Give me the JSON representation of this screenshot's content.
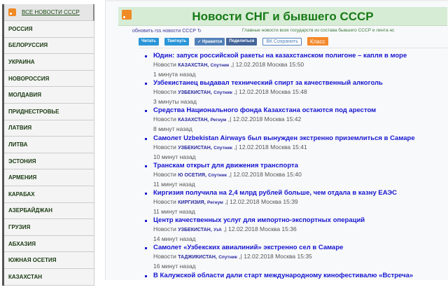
{
  "sidebar": {
    "all_label": "ВСЕ НОВОСТИ СССР",
    "items": [
      "РОССИЯ",
      "БЕЛОРУССИЯ",
      "УКРАИНА",
      "НОВОРОССИЯ",
      "МОЛДАВИЯ",
      "ПРИДНЕСТРОВЬЕ",
      "ЛАТВИЯ",
      "ЛИТВА",
      "ЭСТОНИЯ",
      "АРМЕНИЯ",
      "КАРАБАХ",
      "АЗЕРБАЙДЖАН",
      "ГРУЗИЯ",
      "АБХАЗИЯ",
      "ЮЖНАЯ ОСЕТИЯ",
      "КАЗАХСТАН"
    ]
  },
  "header": {
    "title": "Новости СНГ и бывшего СССР",
    "refresh_link": "обновить rss новости СССР ↻",
    "subtitle": "Главные новости всех государств из состава бывшего СССР и лента нс"
  },
  "share": {
    "read": "Читать",
    "tweet": "Твитнуть",
    "like": "✓ Нравится",
    "share": "Поделиться",
    "vk_save": "ВК Сохранить",
    "ok": "Класс"
  },
  "news": [
    {
      "title": "Юдин: запуск российской ракеты на казахстанском полигоне – капля в море",
      "prefix": "Новости",
      "country": "КАЗАХСТАН,",
      "source": "Спутник",
      "date": ",| 12.02.2018 Москва 15:50",
      "ago": "1 минута назад"
    },
    {
      "title": "Узбекистанец выдавал технический спирт за качественный алкоголь",
      "prefix": "Новости",
      "country": "УЗБЕКИСТАН,",
      "source": "Спутник",
      "date": ",| 12.02.2018 Москва 15:48",
      "ago": "3 минуты назад"
    },
    {
      "title": "Средства Национального фонда Казахстана остаются под арестом",
      "prefix": "Новости",
      "country": "КАЗАХСТАН,",
      "source": "Регнум",
      "date": ",| 12.02.2018 Москва 15:42",
      "ago": "8 минут назад"
    },
    {
      "title": "Самолет Uzbekistan Airways был вынужден экстренно приземлиться в Самаре",
      "prefix": "Новости",
      "country": "УЗБЕКИСТАН,",
      "source": "Спутник",
      "date": ",| 12.02.2018 Москва 15:41",
      "ago": "10 минут назад"
    },
    {
      "title": "Транскам открыт для движения транспорта",
      "prefix": "Новости",
      "country": "Ю ОСЕТИЯ,",
      "source": "Спутник",
      "date": ",| 12.02.2018 Москва 15:40",
      "ago": "11 минут назад"
    },
    {
      "title": "Киргизия получила на 2,4 млрд рублей больше, чем отдала в казну ЕАЭС",
      "prefix": "Новости",
      "country": "КИРГИЗИЯ,",
      "source": "Регнум",
      "date": ",| 12.02.2018 Москва 15:39",
      "ago": "11 минут назад"
    },
    {
      "title": "Центр качественных услуг для импортно-экспортных операций",
      "prefix": "Новости",
      "country": "УЗБЕКИСТАН,",
      "source": "УзА",
      "date": ",| 12.02.2018 Москва 15:36",
      "ago": "14 минут назад"
    },
    {
      "title": "Самолет «Узбекских авиалиний» экстренно сел в Самаре",
      "prefix": "Новости",
      "country": "ТАДЖИКИСТАН,",
      "source": "Спутник",
      "date": ",| 12.02.2018 Москва 15:35",
      "ago": "16 минут назад"
    },
    {
      "title": "В Калужской области дали старт международному кинофестивалю «Встреча»",
      "prefix": "",
      "country": "",
      "source": "",
      "date": "",
      "ago": ""
    }
  ]
}
